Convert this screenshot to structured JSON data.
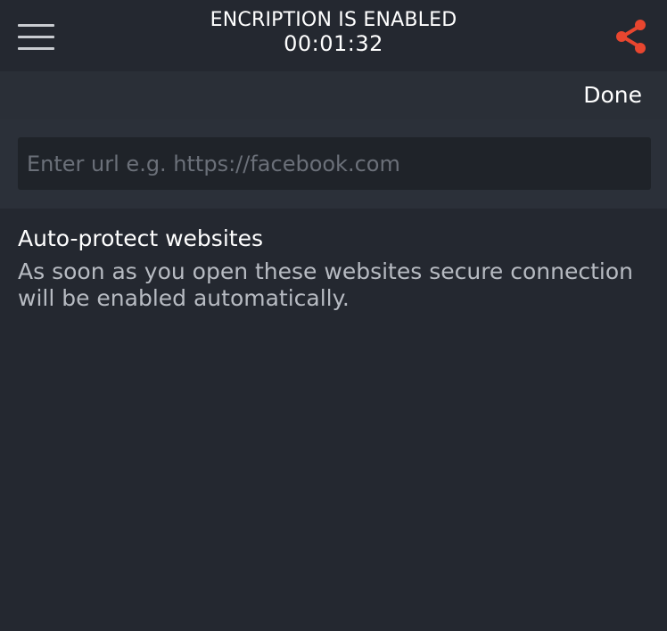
{
  "header": {
    "title": "ENCRIPTION IS ENABLED",
    "timer": "00:01:32",
    "menu_icon": "hamburger-menu-icon",
    "share_icon": "share-icon"
  },
  "toolbar": {
    "done_label": "Done"
  },
  "url_field": {
    "placeholder": "Enter url e.g. https://facebook.com",
    "value": ""
  },
  "info": {
    "title": "Auto-protect websites",
    "description": "As soon as you open these websites secure connection will be enabled automatically."
  },
  "colors": {
    "background": "#242830",
    "toolbar": "#2a2f37",
    "input_background": "#1f2329",
    "accent": "#e8462f",
    "text_primary": "#ffffff",
    "text_secondary": "#b7bbc2"
  }
}
